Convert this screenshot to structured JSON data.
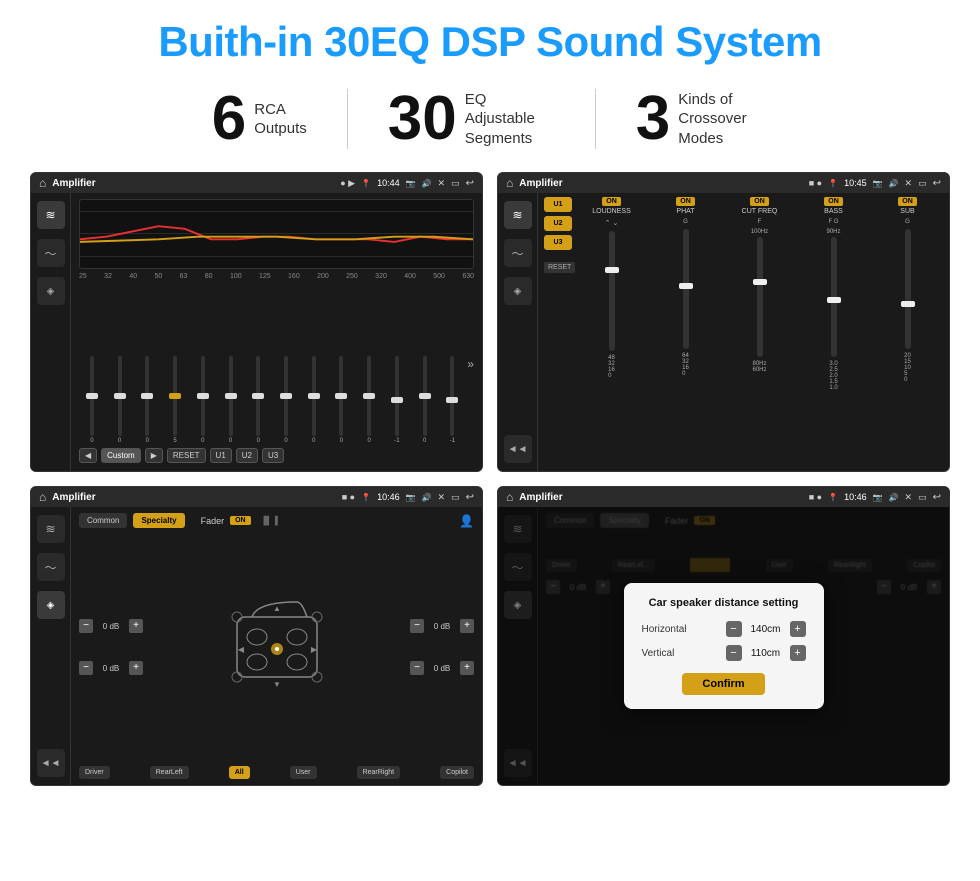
{
  "page": {
    "title": "Buith-in 30EQ DSP Sound System",
    "stats": [
      {
        "number": "6",
        "label": "RCA\nOutputs"
      },
      {
        "number": "30",
        "label": "EQ Adjustable\nSegments"
      },
      {
        "number": "3",
        "label": "Kinds of\nCrossover Modes"
      }
    ],
    "screens": [
      {
        "id": "eq-screen",
        "title": "EQ Screen",
        "app_name": "Amplifier",
        "time": "10:44",
        "status_icons": "● ▶",
        "eq_freqs": [
          "25",
          "32",
          "40",
          "50",
          "63",
          "80",
          "100",
          "125",
          "160",
          "200",
          "250",
          "320",
          "400",
          "500",
          "630"
        ],
        "eq_vals": [
          "0",
          "0",
          "0",
          "5",
          "0",
          "0",
          "0",
          "0",
          "0",
          "0",
          "0",
          "-1",
          "0",
          "-1"
        ],
        "eq_buttons": [
          "◀",
          "Custom",
          "▶",
          "RESET",
          "U1",
          "U2",
          "U3"
        ]
      },
      {
        "id": "crossover-screen",
        "title": "Crossover Screen",
        "app_name": "Amplifier",
        "time": "10:45",
        "status_icons": "■ ●",
        "presets": [
          "U1",
          "U2",
          "U3"
        ],
        "channels": [
          "LOUDNESS",
          "PHAT",
          "CUT FREQ",
          "BASS",
          "SUB"
        ],
        "reset_label": "RESET"
      },
      {
        "id": "fader-screen",
        "title": "Fader Screen",
        "app_name": "Amplifier",
        "time": "10:46",
        "status_icons": "■ ●",
        "modes": [
          "Common",
          "Specialty"
        ],
        "fader_label": "Fader",
        "on_label": "ON",
        "levels": [
          {
            "label": "0 dB"
          },
          {
            "label": "0 dB"
          },
          {
            "label": "0 dB"
          },
          {
            "label": "0 dB"
          }
        ],
        "bottom_btns": [
          "Driver",
          "RearLeft",
          "All",
          "User",
          "RearRight",
          "Copilot"
        ]
      },
      {
        "id": "dialog-screen",
        "title": "Dialog Screen",
        "app_name": "Amplifier",
        "time": "10:46",
        "status_icons": "■ ●",
        "dialog": {
          "title": "Car speaker distance setting",
          "horizontal_label": "Horizontal",
          "horizontal_value": "140cm",
          "vertical_label": "Vertical",
          "vertical_value": "110cm",
          "confirm_label": "Confirm"
        },
        "modes": [
          "Common",
          "Specialty"
        ],
        "on_label": "ON",
        "bottom_btns": [
          "Driver",
          "RearLef...",
          "All",
          "User",
          "RearRight",
          "Copilot"
        ]
      }
    ]
  }
}
